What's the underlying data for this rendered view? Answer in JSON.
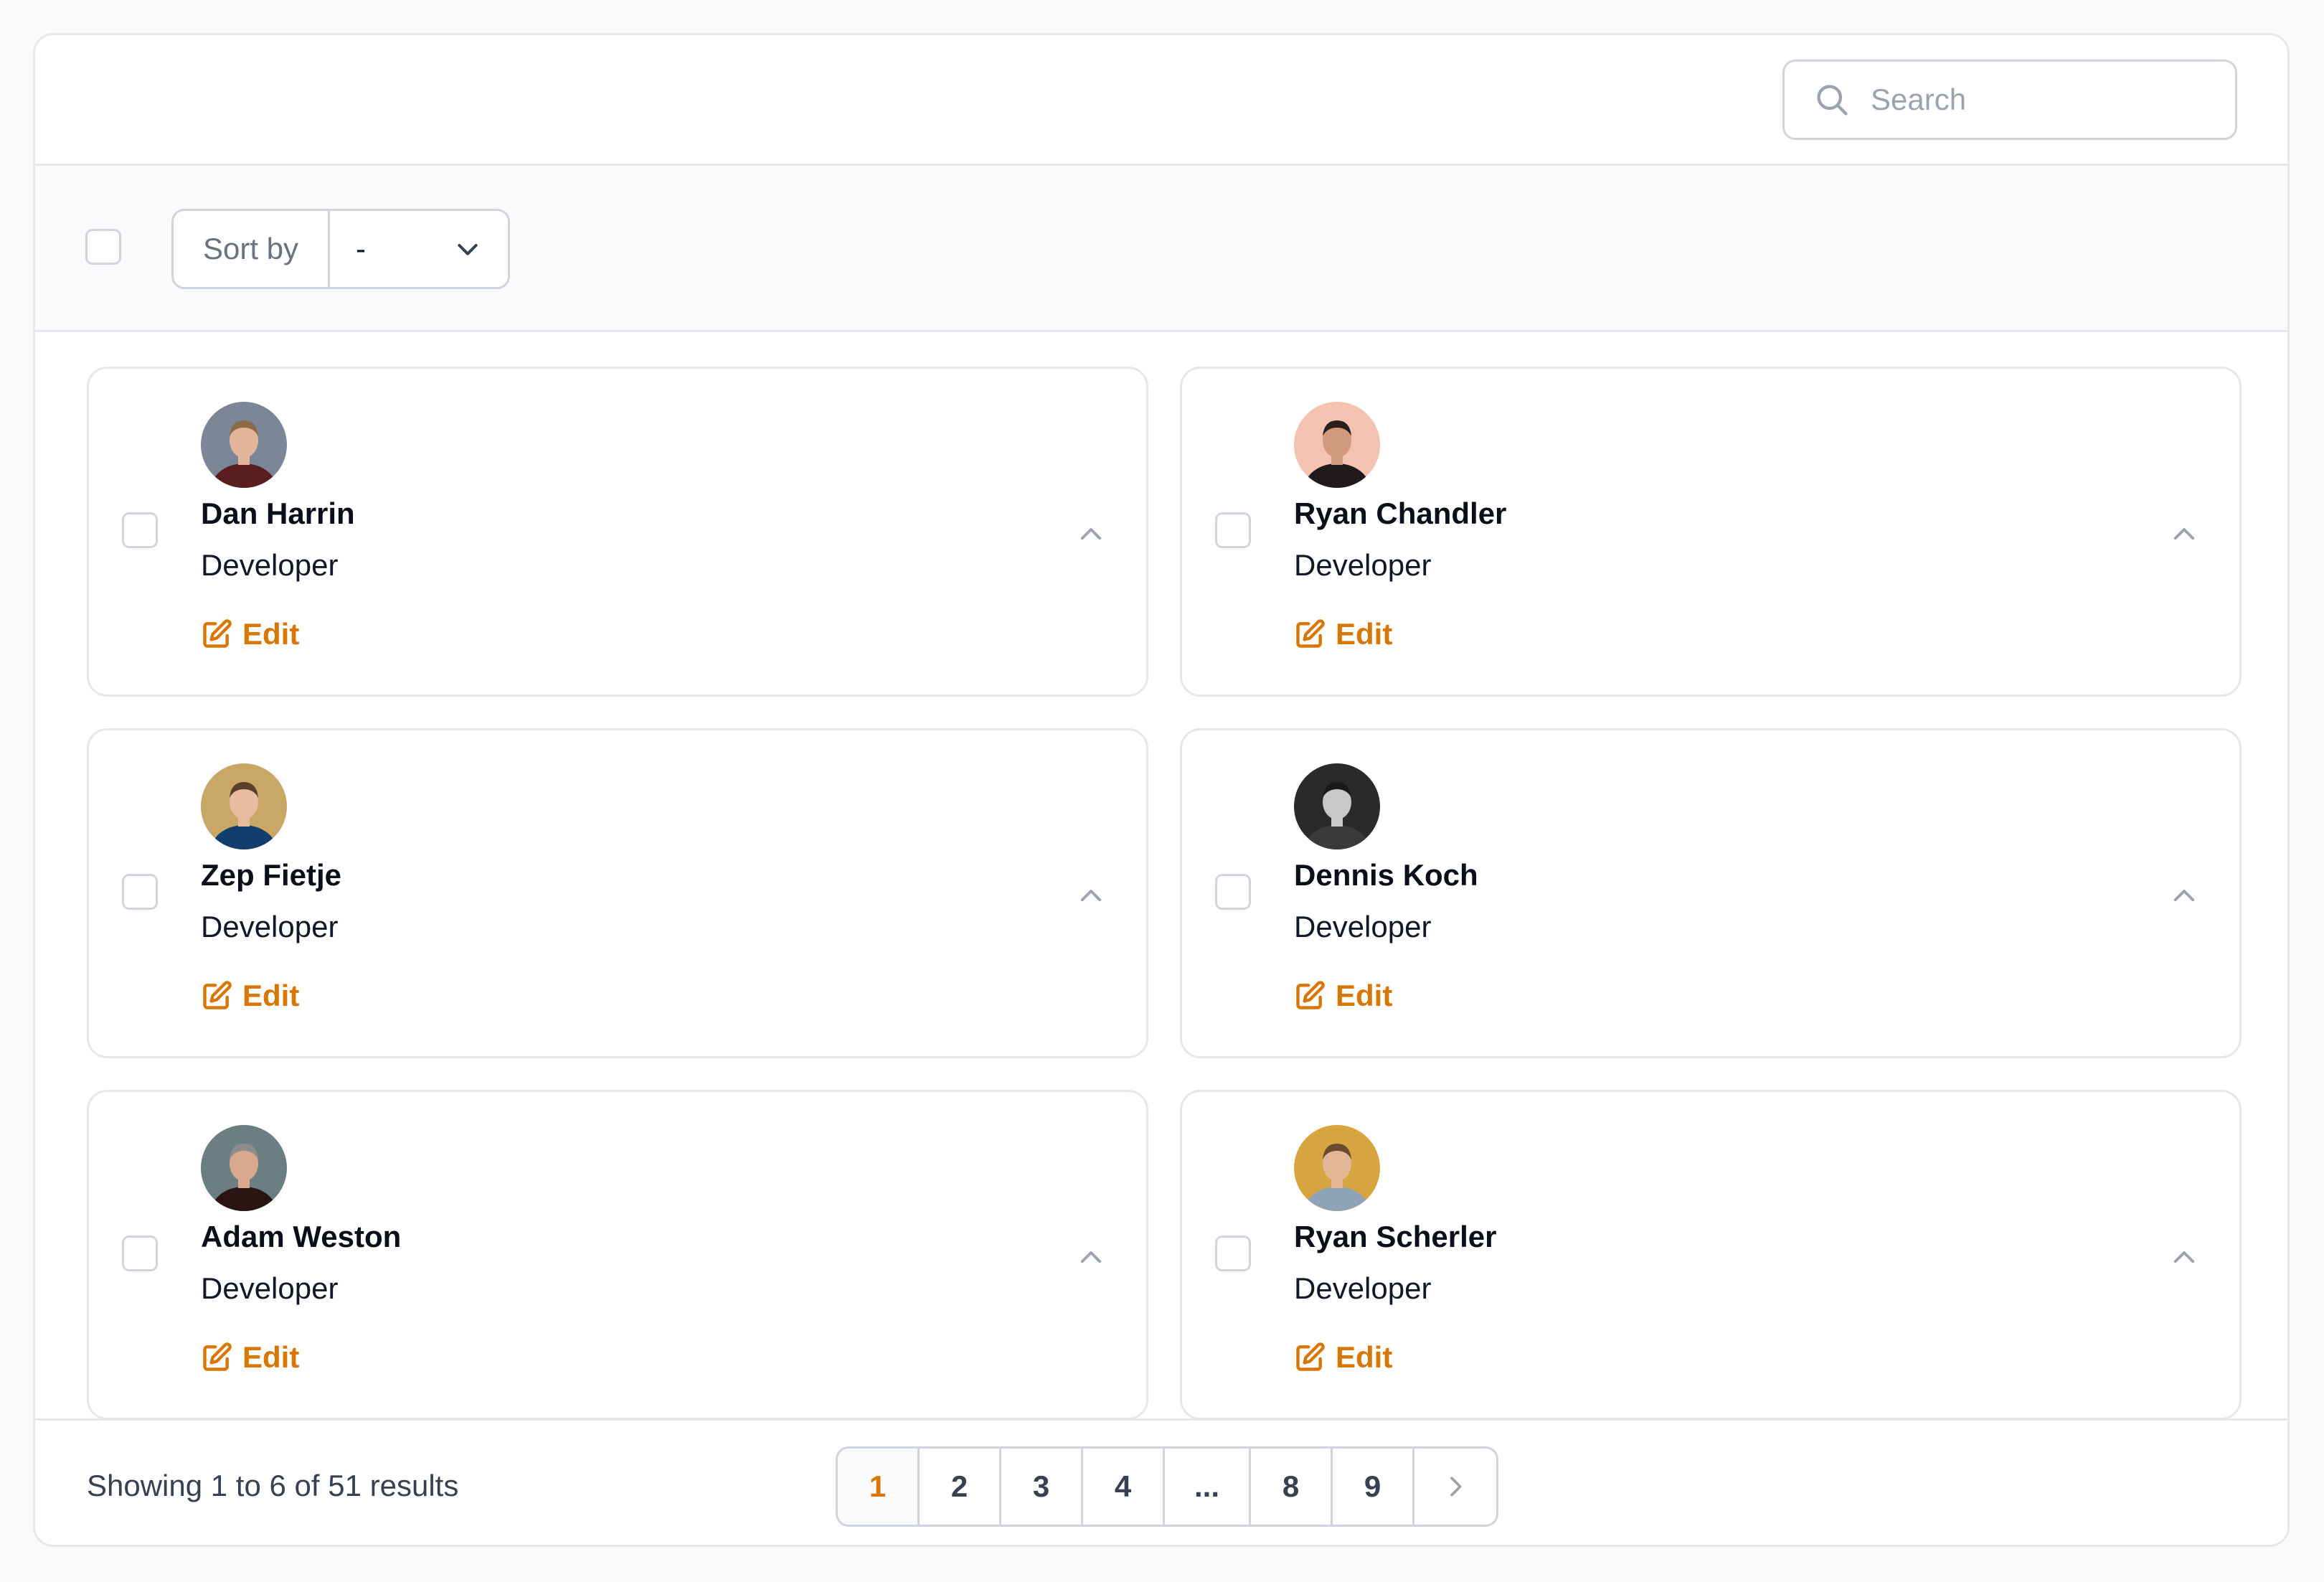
{
  "header": {
    "search_placeholder": "Search"
  },
  "toolbar": {
    "sort_label": "Sort by",
    "sort_value": "-"
  },
  "cards": [
    {
      "name": "Dan Harrin",
      "role": "Developer",
      "edit_label": "Edit",
      "avatar_bg": "#7b8797",
      "avatar_shirt": "#5a1e1e",
      "avatar_skin": "#e2b59a",
      "avatar_hair": "#8a6b45"
    },
    {
      "name": "Ryan Chandler",
      "role": "Developer",
      "edit_label": "Edit",
      "avatar_bg": "#f3c2b0",
      "avatar_shirt": "#1f1a1a",
      "avatar_skin": "#d29a7c",
      "avatar_hair": "#2b1d17"
    },
    {
      "name": "Zep Fietje",
      "role": "Developer",
      "edit_label": "Edit",
      "avatar_bg": "#c9a867",
      "avatar_shirt": "#123e6e",
      "avatar_skin": "#e7bca0",
      "avatar_hair": "#5b3f26"
    },
    {
      "name": "Dennis Koch",
      "role": "Developer",
      "edit_label": "Edit",
      "avatar_bg": "#2a2a2a",
      "avatar_shirt": "#3a3a3a",
      "avatar_skin": "#c8c8c8",
      "avatar_hair": "#1a1a1a"
    },
    {
      "name": "Adam Weston",
      "role": "Developer",
      "edit_label": "Edit",
      "avatar_bg": "#6b7f82",
      "avatar_shirt": "#2a1313",
      "avatar_skin": "#d9a98d",
      "avatar_hair": "#8d8d8d"
    },
    {
      "name": "Ryan Scherler",
      "role": "Developer",
      "edit_label": "Edit",
      "avatar_bg": "#d6a53f",
      "avatar_shirt": "#8fa3b8",
      "avatar_skin": "#e3b697",
      "avatar_hair": "#6a4a2c"
    }
  ],
  "footer": {
    "showing": "Showing 1 to 6 of 51 results",
    "pages": [
      "1",
      "2",
      "3",
      "4",
      "...",
      "8",
      "9"
    ],
    "active_page": "1"
  },
  "colors": {
    "accent": "#d97706",
    "border": "#e5e7eb"
  }
}
